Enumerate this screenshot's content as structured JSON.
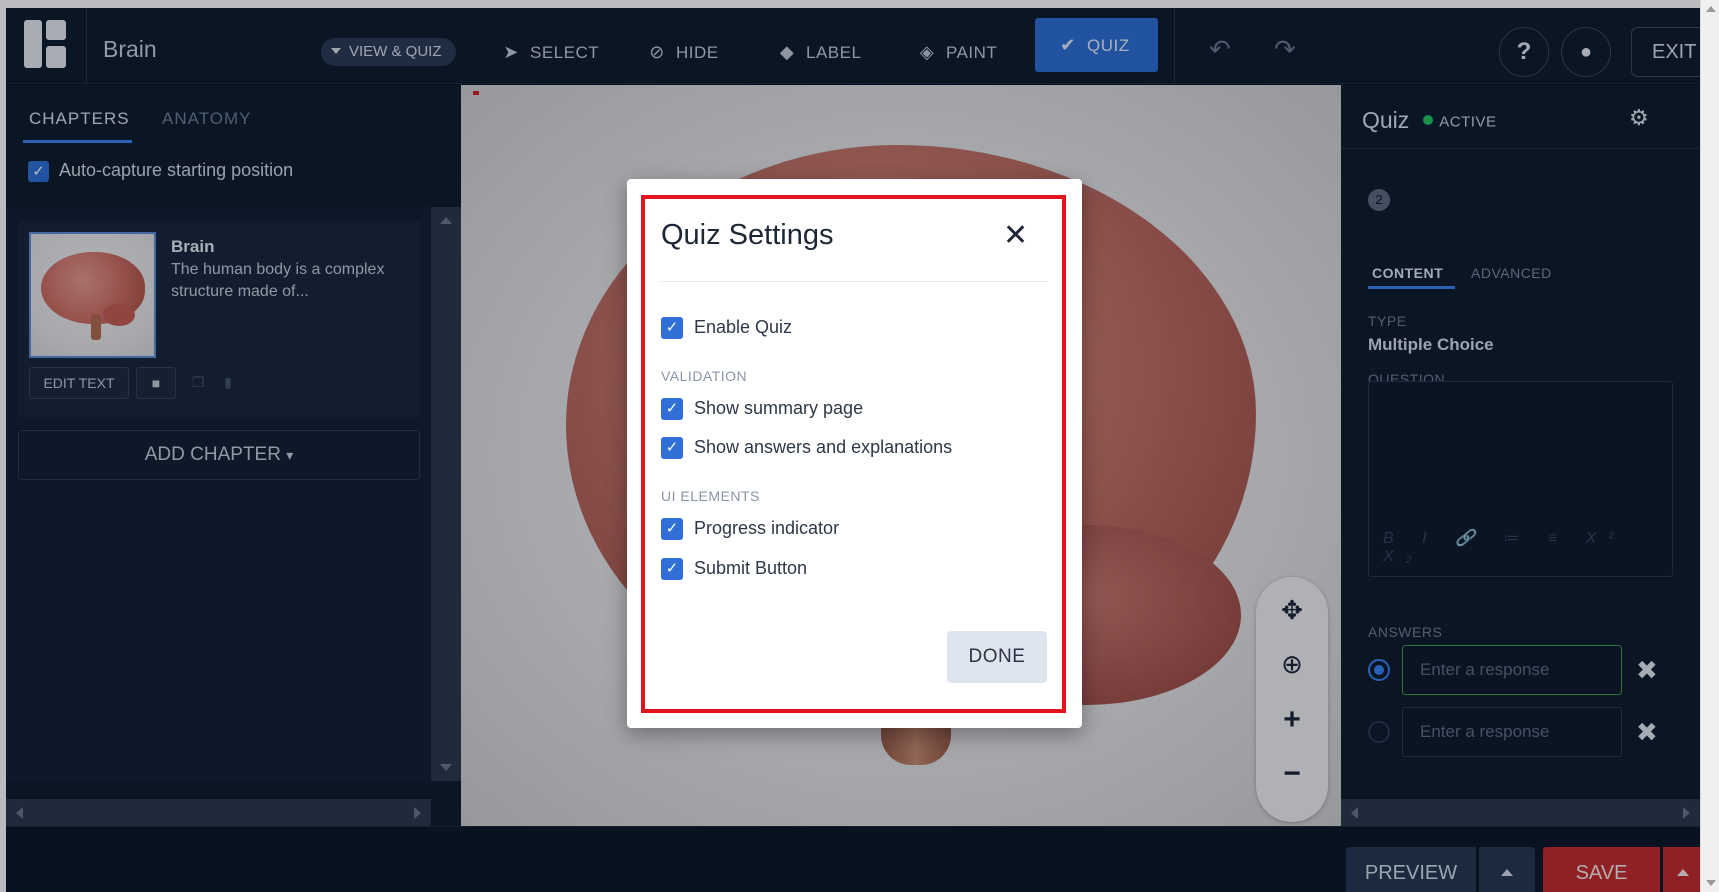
{
  "header": {
    "title": "Brain",
    "view_quiz_label": "VIEW & QUIZ",
    "tools": [
      {
        "label": "SELECT",
        "icon": "cursor-icon"
      },
      {
        "label": "HIDE",
        "icon": "eye-slash-icon"
      },
      {
        "label": "LABEL",
        "icon": "tag-icon"
      },
      {
        "label": "PAINT",
        "icon": "paint-bucket-icon"
      },
      {
        "label": "QUIZ",
        "icon": "check-icon",
        "active": true
      }
    ],
    "help_label": "?",
    "exit_label": "EXIT"
  },
  "left_panel": {
    "tabs": [
      {
        "label": "CHAPTERS",
        "active": true
      },
      {
        "label": "ANATOMY",
        "active": false
      }
    ],
    "auto_capture_label": "Auto-capture starting position",
    "auto_capture_checked": true,
    "chapter": {
      "title": "Brain",
      "description": "The human body is a complex structure made of..."
    },
    "edit_text_label": "EDIT TEXT",
    "add_chapter_label": "ADD CHAPTER"
  },
  "right_panel": {
    "title": "Quiz",
    "status": "ACTIVE",
    "step": "2",
    "tabs": [
      {
        "label": "CONTENT",
        "active": true
      },
      {
        "label": "ADVANCED",
        "active": false
      }
    ],
    "type_label": "TYPE",
    "type_value": "Multiple Choice",
    "question_label": "QUESTION",
    "format_tools": "B I 🔗 ≔ ≡ X² X₂",
    "answers_label": "ANSWERS",
    "answers": [
      {
        "placeholder": "Enter a response",
        "selected": true
      },
      {
        "placeholder": "Enter a response",
        "selected": false
      }
    ]
  },
  "footer": {
    "preview_label": "PREVIEW",
    "save_label": "SAVE"
  },
  "modal": {
    "title": "Quiz Settings",
    "enable_quiz_label": "Enable Quiz",
    "validation_section": "VALIDATION",
    "show_summary_label": "Show summary page",
    "show_answers_label": "Show answers and explanations",
    "ui_elements_section": "UI ELEMENTS",
    "progress_indicator_label": "Progress indicator",
    "submit_button_label": "Submit Button",
    "done_label": "DONE",
    "all_checked": true
  },
  "colors": {
    "accent": "#2f6fd6",
    "danger": "#c52a2a",
    "highlight_border": "#e3141d",
    "status_active": "#22c55e",
    "dark_bg": "#0f1b2b"
  }
}
